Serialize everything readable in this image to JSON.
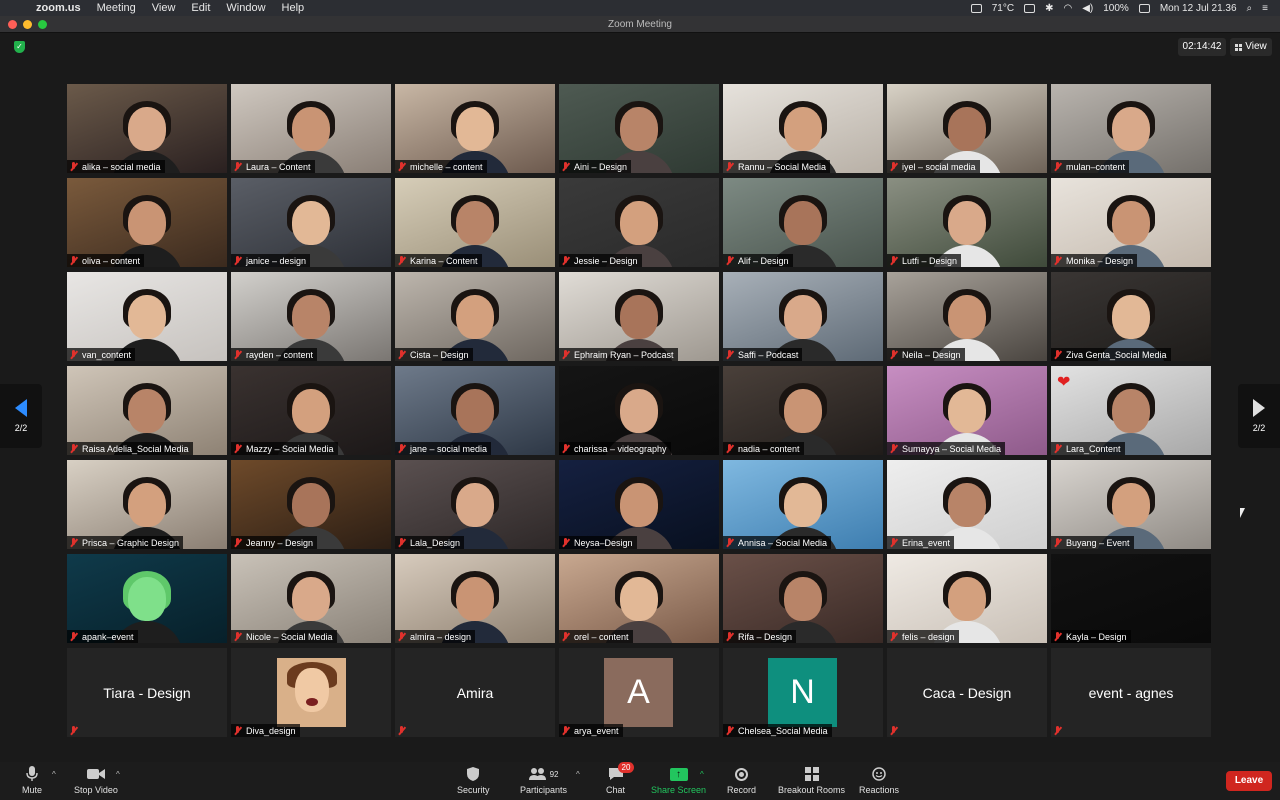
{
  "menubar": {
    "app": "zoom.us",
    "items": [
      "Meeting",
      "View",
      "Edit",
      "Window",
      "Help"
    ],
    "status": {
      "temp": "71°C",
      "battery": "100%",
      "datetime": "Mon 12 Jul  21.36"
    }
  },
  "window": {
    "title": "Zoom Meeting"
  },
  "meeting": {
    "timer": "02:14:42",
    "view_label": "View"
  },
  "pager": {
    "left": "2/2",
    "right": "2/2"
  },
  "colors": {
    "accent": "#2d8cff",
    "share": "#22c55e",
    "danger": "#e0312c",
    "leave": "#d0261f"
  },
  "participants": [
    {
      "name": "alika – social media",
      "type": "video"
    },
    {
      "name": "Laura – Content",
      "type": "video"
    },
    {
      "name": "michelle – content",
      "type": "video"
    },
    {
      "name": "Aini – Design",
      "type": "video"
    },
    {
      "name": "Rannu – Social Media",
      "type": "video"
    },
    {
      "name": "iyel – social media",
      "type": "video"
    },
    {
      "name": "mulan–content",
      "type": "video"
    },
    {
      "name": "oliva – content",
      "type": "video"
    },
    {
      "name": "janice – design",
      "type": "video"
    },
    {
      "name": "Karina – Content",
      "type": "video"
    },
    {
      "name": "Jessie – Design",
      "type": "video"
    },
    {
      "name": "Alif – Design",
      "type": "video"
    },
    {
      "name": "Lutfi – Design",
      "type": "video"
    },
    {
      "name": "Monika – Design",
      "type": "video"
    },
    {
      "name": "van_content",
      "type": "video"
    },
    {
      "name": "rayden – content",
      "type": "video"
    },
    {
      "name": "Cista – Design",
      "type": "video"
    },
    {
      "name": "Ephraim Ryan – Podcast",
      "type": "video"
    },
    {
      "name": "Saffi – Podcast",
      "type": "video"
    },
    {
      "name": "Neila – Design",
      "type": "video"
    },
    {
      "name": "Ziva Genta_Social Media",
      "type": "video"
    },
    {
      "name": "Raisa Adelia_Social Media",
      "type": "video"
    },
    {
      "name": "Mazzy – Social Media",
      "type": "video"
    },
    {
      "name": "jane – social media",
      "type": "video"
    },
    {
      "name": "charissa – videography",
      "type": "video"
    },
    {
      "name": "nadia – content",
      "type": "video"
    },
    {
      "name": "Sumayya – Social Media",
      "type": "video"
    },
    {
      "name": "Lara_Content",
      "type": "video"
    },
    {
      "name": "Prisca – Graphic Design",
      "type": "video"
    },
    {
      "name": "Jeanny – Design",
      "type": "video"
    },
    {
      "name": "Lala_Design",
      "type": "video"
    },
    {
      "name": "Neysa–Design",
      "type": "video"
    },
    {
      "name": "Annisa – Social Media",
      "type": "video"
    },
    {
      "name": "Erina_event",
      "type": "video"
    },
    {
      "name": "Buyang – Event",
      "type": "video"
    },
    {
      "name": "apank–event",
      "type": "video"
    },
    {
      "name": "Nicole – Social Media",
      "type": "video"
    },
    {
      "name": "almira – design",
      "type": "video"
    },
    {
      "name": "orel – content",
      "type": "video"
    },
    {
      "name": "Rifa – Design",
      "type": "video"
    },
    {
      "name": "felis – design",
      "type": "video"
    },
    {
      "name": "Kayla – Design",
      "type": "video"
    },
    {
      "name": "Tiara - Design",
      "type": "nameonly"
    },
    {
      "name": "Diva_design",
      "type": "photo"
    },
    {
      "name": "Amira",
      "type": "nameonly"
    },
    {
      "name": "arya_event",
      "type": "letter",
      "letter": "A",
      "color": "#8a6b5d"
    },
    {
      "name": "Chelsea_Social Media",
      "type": "letter",
      "letter": "N",
      "color": "#0e8f7e"
    },
    {
      "name": "Caca - Design",
      "type": "nameonly"
    },
    {
      "name": "event - agnes",
      "type": "nameonly"
    }
  ],
  "toolbar": {
    "mute": "Mute",
    "stop_video": "Stop Video",
    "security": "Security",
    "participants": "Participants",
    "participants_count": "92",
    "chat": "Chat",
    "chat_badge": "20",
    "share": "Share Screen",
    "record": "Record",
    "breakout": "Breakout Rooms",
    "reactions": "Reactions",
    "leave": "Leave"
  }
}
